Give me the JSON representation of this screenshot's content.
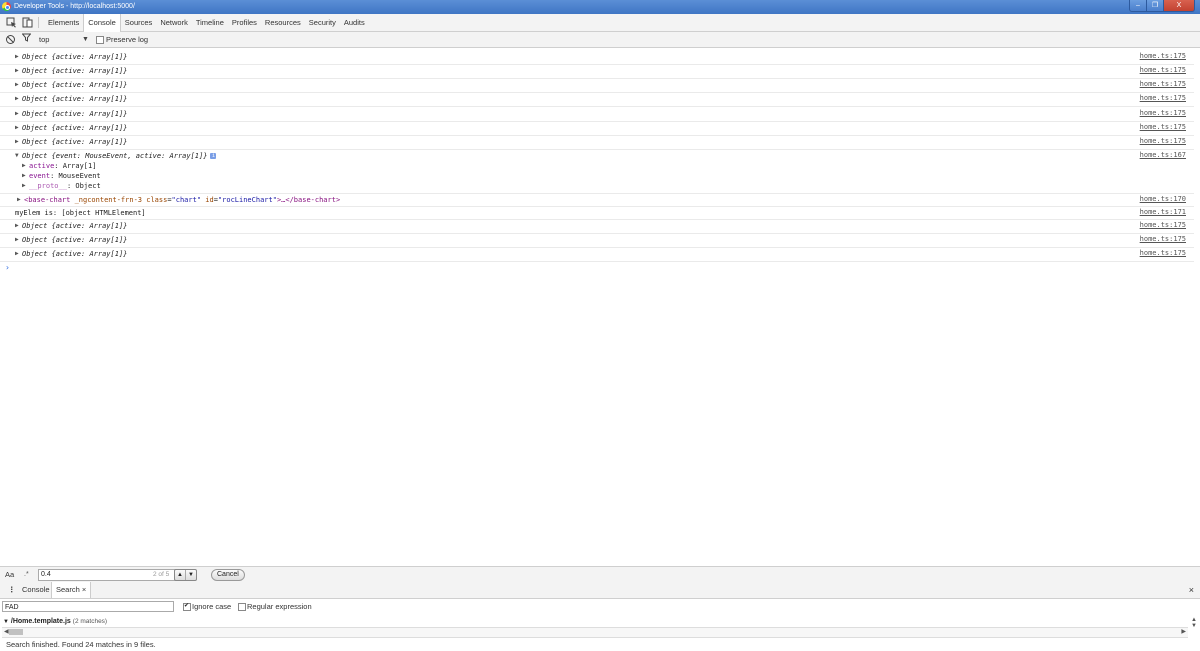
{
  "window": {
    "title": "Developer Tools - http://localhost:5000/",
    "buttons": {
      "minimize": "–",
      "maximize": "❐",
      "close": "X"
    }
  },
  "tabs": [
    "Elements",
    "Console",
    "Sources",
    "Network",
    "Timeline",
    "Profiles",
    "Resources",
    "Security",
    "Audits"
  ],
  "toolbar": {
    "context": "top",
    "preserve_log": "Preserve log"
  },
  "console": {
    "object_prefix": "Object",
    "active_summary": "{active: Array[1]}",
    "expanded_summary": "{event: MouseEvent, active: Array[1]}",
    "expanded_badge": "i",
    "prop_active_key": "active",
    "prop_active_val": ": Array[1]",
    "prop_event_key": "event",
    "prop_event_val": ": MouseEvent",
    "prop_proto_key": "__proto__",
    "prop_proto_val": ": Object",
    "element_open": "<base-chart",
    "element_attr1": "_ngcontent-frn-3",
    "element_attr2_name": "class",
    "element_attr2_val": "\"chart\"",
    "element_attr3_name": "id",
    "element_attr3_val": "\"rocLineChart\"",
    "element_close": ">…</base-chart>",
    "myelem_text": "myElem is: [object HTMLElement]",
    "src_175": "home.ts:175",
    "src_167": "home.ts:167",
    "src_170": "home.ts:170",
    "src_171": "home.ts:171",
    "prompt": "›"
  },
  "searchbar": {
    "case_label": "Aa",
    "regex_label": ".*",
    "value": "0.4",
    "match_count": "2 of 5",
    "cancel": "Cancel"
  },
  "drawer": {
    "tabs": [
      "Console",
      "Search"
    ],
    "close_glyph": "×",
    "query": "FAD",
    "ignore_case": "Ignore case",
    "regular_expression": "Regular expression",
    "result_file": "/Home.template.js",
    "result_count": "(2 matches)",
    "status": "Search finished.  Found 24 matches in 9 files."
  }
}
